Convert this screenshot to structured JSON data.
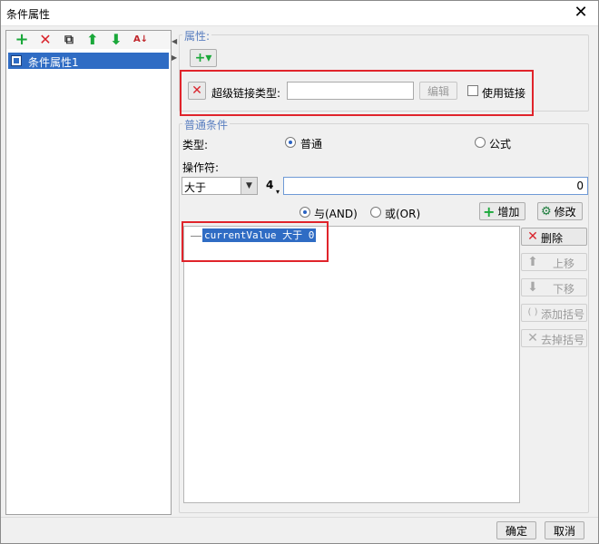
{
  "window": {
    "title": "条件属性",
    "close_glyph": "✕"
  },
  "left_toolbar": {
    "icons": [
      "add-icon",
      "delete-icon",
      "copy-icon",
      "move-up-icon",
      "move-down-icon",
      "sort-icon"
    ],
    "add_glyph": "+",
    "delete_glyph": "✕",
    "copy_glyph": "⧉",
    "up_glyph": "⬆",
    "down_glyph": "⬇",
    "sort_glyph": "A↓"
  },
  "tree": {
    "items": [
      {
        "label": "条件属性1"
      }
    ]
  },
  "properties": {
    "group_title": "属性:",
    "add_glyph": "+▾",
    "remove_glyph": "✕",
    "hyperlink_type_label": "超级链接类型:",
    "hyperlink_type_value": "",
    "edit_button": "编辑",
    "use_link_label": "使用链接",
    "use_link_checked": false
  },
  "normal_condition": {
    "group_title": "普通条件",
    "type_label": "类型:",
    "type_options": [
      "普通",
      "公式"
    ],
    "type_selected": "普通",
    "operator_label": "操作符:",
    "operator_value": "大于",
    "dropdown_glyph": "▼",
    "value_type_glyph": "4",
    "operand_value": "0",
    "logic_options": [
      "与(AND)",
      "或(OR)"
    ],
    "logic_selected": "与(AND)",
    "add_button": "增加",
    "modify_button": "修改",
    "condition_list": [
      "currentValue 大于 0"
    ]
  },
  "side_buttons": [
    {
      "label": "删除",
      "icon": "✕",
      "enabled": true
    },
    {
      "label": "上移",
      "icon": "⬆",
      "enabled": false
    },
    {
      "label": "下移",
      "icon": "⬇",
      "enabled": false
    },
    {
      "label": "添加括号",
      "icon": "( )",
      "enabled": false
    },
    {
      "label": "去掉括号",
      "icon": "✕",
      "enabled": false
    }
  ],
  "footer": {
    "ok_button": "确定",
    "cancel_button": "取消"
  },
  "colors": {
    "accent": "#2f6cc4",
    "highlight_frame": "#e0242b",
    "add_green": "#1aa83a",
    "delete_red": "#d9232b"
  }
}
